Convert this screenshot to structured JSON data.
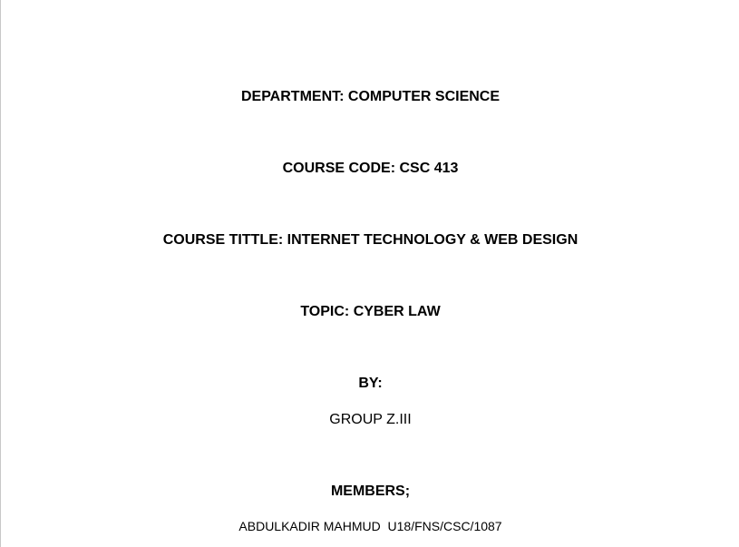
{
  "document": {
    "department": "DEPARTMENT: COMPUTER SCIENCE",
    "course_code": "COURSE CODE: CSC 413",
    "course_title": "COURSE TITTLE: INTERNET TECHNOLOGY & WEB DESIGN",
    "topic": "TOPIC: CYBER LAW",
    "by_label": "BY:",
    "group": "GROUP Z.III",
    "members_label": "MEMBERS;",
    "members": [
      "ABDULKADIR MAHMUD  U18/FNS/CSC/1087"
    ]
  }
}
